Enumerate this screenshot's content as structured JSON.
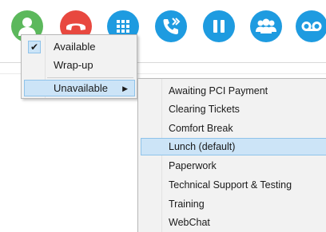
{
  "toolbar": {
    "buttons": [
      {
        "id": "status",
        "icon": "agent-status-icon",
        "color": "#5cb85c"
      },
      {
        "id": "hangup",
        "icon": "hangup-phone-icon",
        "color": "#e8483f"
      },
      {
        "id": "dialpad",
        "icon": "dialpad-icon",
        "color": "#1e9be0"
      },
      {
        "id": "transfer",
        "icon": "transfer-call-icon",
        "color": "#1e9be0"
      },
      {
        "id": "hold",
        "icon": "pause-icon",
        "color": "#1e9be0"
      },
      {
        "id": "conference",
        "icon": "conference-icon",
        "color": "#1e9be0"
      },
      {
        "id": "voicemail",
        "icon": "voicemail-icon",
        "color": "#1e9be0"
      }
    ]
  },
  "status_menu": {
    "items": [
      {
        "label": "Available",
        "checked": true
      },
      {
        "label": "Wrap-up",
        "checked": false
      },
      {
        "label": "Unavailable",
        "has_submenu": true,
        "highlighted": true
      }
    ],
    "submenu_arrow": "▶"
  },
  "unavailable_submenu": {
    "items": [
      {
        "label": "Awaiting PCI Payment"
      },
      {
        "label": "Clearing Tickets"
      },
      {
        "label": "Comfort Break"
      },
      {
        "label": "Lunch (default)",
        "selected": true
      },
      {
        "label": "Paperwork"
      },
      {
        "label": "Technical Support & Testing"
      },
      {
        "label": "Training"
      },
      {
        "label": "WebChat"
      }
    ]
  },
  "colors": {
    "menu_bg": "#f2f2f2",
    "highlight_bg": "#cce4f7",
    "highlight_border": "#8fc3ea",
    "green": "#5cb85c",
    "red": "#e8483f",
    "blue": "#1e9be0"
  },
  "check_glyph": "✔"
}
